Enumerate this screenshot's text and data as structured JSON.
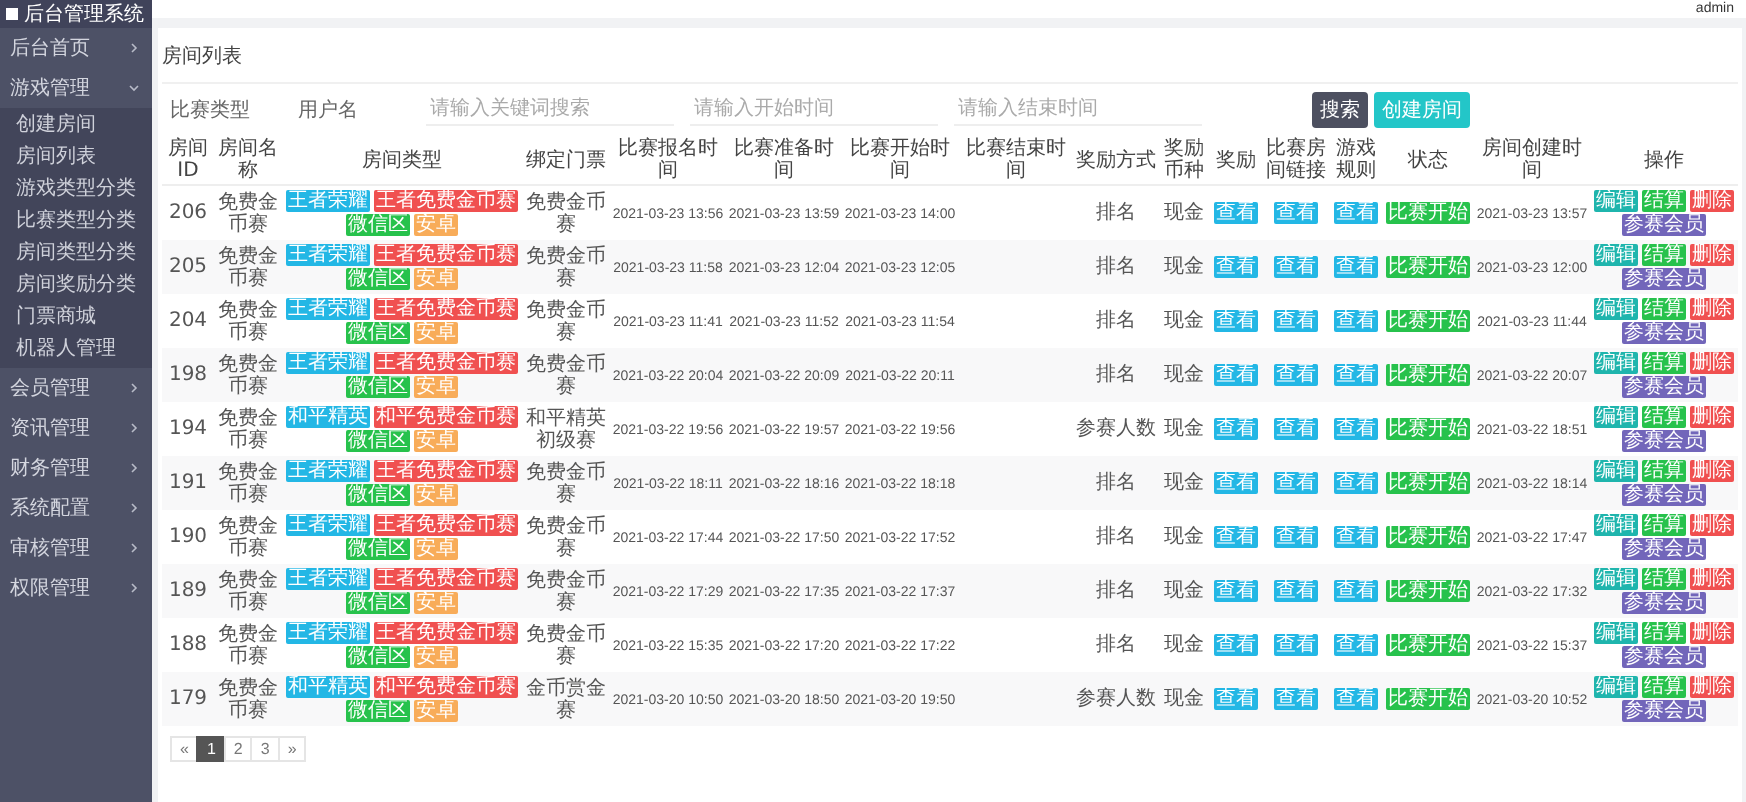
{
  "header": {
    "brand": "后台管理系统",
    "user": "admin"
  },
  "sidebar": {
    "items": [
      {
        "label": "后台首页",
        "expanded": false
      },
      {
        "label": "游戏管理",
        "expanded": true,
        "children": [
          "创建房间",
          "房间列表",
          "游戏类型分类",
          "比赛类型分类",
          "房间类型分类",
          "房间奖励分类",
          "门票商城",
          "机器人管理"
        ]
      },
      {
        "label": "会员管理",
        "expanded": false
      },
      {
        "label": "资讯管理",
        "expanded": false
      },
      {
        "label": "财务管理",
        "expanded": false
      },
      {
        "label": "系统配置",
        "expanded": false
      },
      {
        "label": "审核管理",
        "expanded": false
      },
      {
        "label": "权限管理",
        "expanded": false
      }
    ]
  },
  "page_title": "房间列表",
  "filters": {
    "labels": [
      "比赛类型",
      "用户名"
    ],
    "inputs": [
      {
        "placeholder": "请输入关键词搜索"
      },
      {
        "placeholder": "请输入开始时间"
      },
      {
        "placeholder": "请输入结束时间"
      }
    ],
    "buttons": [
      {
        "label": "搜索",
        "kind": "search"
      },
      {
        "label": "创建房间",
        "kind": "create"
      }
    ]
  },
  "table": {
    "columns": [
      "房间ID",
      "房间名称",
      "房间类型",
      "绑定门票",
      "比赛报名时间",
      "比赛准备时间",
      "比赛开始时间",
      "比赛结束时间",
      "奖励方式",
      "奖励币种",
      "奖励",
      "比赛房间链接",
      "游戏规则",
      "状态",
      "房间创建时间",
      "操作"
    ],
    "rows": [
      {
        "id": "206",
        "name": "免费金币赛",
        "type_tags": [
          {
            "text": "王者荣耀",
            "color": "#23b7e5"
          },
          {
            "text": "王者免费金币赛",
            "color": "#f05050"
          },
          {
            "text": "微信区",
            "color": "#27c24c"
          },
          {
            "text": "安卓",
            "color": "#f8ac59"
          }
        ],
        "ticket": "免费金币赛",
        "signup_time": "2021-03-23 13:56",
        "prepare_time": "2021-03-23 13:59",
        "start_time": "2021-03-23 14:00",
        "reward_mode": "排名",
        "currency": "现金",
        "reward": "查看",
        "room_link": "查看",
        "rules": "查看",
        "status": "比赛开始",
        "created_time": "2021-03-23 13:57",
        "actions": [
          {
            "label": "编辑",
            "color": "#1fb5ad"
          },
          {
            "label": "结算",
            "color": "#27c24c"
          },
          {
            "label": "删除",
            "color": "#f05050"
          },
          {
            "label": "参赛会员",
            "color": "#7266ba"
          }
        ]
      },
      {
        "id": "205",
        "name": "免费金币赛",
        "type_tags": [
          {
            "text": "王者荣耀",
            "color": "#23b7e5"
          },
          {
            "text": "王者免费金币赛",
            "color": "#f05050"
          },
          {
            "text": "微信区",
            "color": "#27c24c"
          },
          {
            "text": "安卓",
            "color": "#f8ac59"
          }
        ],
        "ticket": "免费金币赛",
        "signup_time": "2021-03-23 11:58",
        "prepare_time": "2021-03-23 12:04",
        "start_time": "2021-03-23 12:05",
        "reward_mode": "排名",
        "currency": "现金",
        "reward": "查看",
        "room_link": "查看",
        "rules": "查看",
        "status": "比赛开始",
        "created_time": "2021-03-23 12:00",
        "actions": [
          {
            "label": "编辑",
            "color": "#1fb5ad"
          },
          {
            "label": "结算",
            "color": "#27c24c"
          },
          {
            "label": "删除",
            "color": "#f05050"
          },
          {
            "label": "参赛会员",
            "color": "#7266ba"
          }
        ]
      },
      {
        "id": "204",
        "name": "免费金币赛",
        "type_tags": [
          {
            "text": "王者荣耀",
            "color": "#23b7e5"
          },
          {
            "text": "王者免费金币赛",
            "color": "#f05050"
          },
          {
            "text": "微信区",
            "color": "#27c24c"
          },
          {
            "text": "安卓",
            "color": "#f8ac59"
          }
        ],
        "ticket": "免费金币赛",
        "signup_time": "2021-03-23 11:41",
        "prepare_time": "2021-03-23 11:52",
        "start_time": "2021-03-23 11:54",
        "reward_mode": "排名",
        "currency": "现金",
        "reward": "查看",
        "room_link": "查看",
        "rules": "查看",
        "status": "比赛开始",
        "created_time": "2021-03-23 11:44",
        "actions": [
          {
            "label": "编辑",
            "color": "#1fb5ad"
          },
          {
            "label": "结算",
            "color": "#27c24c"
          },
          {
            "label": "删除",
            "color": "#f05050"
          },
          {
            "label": "参赛会员",
            "color": "#7266ba"
          }
        ]
      },
      {
        "id": "198",
        "name": "免费金币赛",
        "type_tags": [
          {
            "text": "王者荣耀",
            "color": "#23b7e5"
          },
          {
            "text": "王者免费金币赛",
            "color": "#f05050"
          },
          {
            "text": "微信区",
            "color": "#27c24c"
          },
          {
            "text": "安卓",
            "color": "#f8ac59"
          }
        ],
        "ticket": "免费金币赛",
        "signup_time": "2021-03-22 20:04",
        "prepare_time": "2021-03-22 20:09",
        "start_time": "2021-03-22 20:11",
        "reward_mode": "排名",
        "currency": "现金",
        "reward": "查看",
        "room_link": "查看",
        "rules": "查看",
        "status": "比赛开始",
        "created_time": "2021-03-22 20:07",
        "actions": [
          {
            "label": "编辑",
            "color": "#1fb5ad"
          },
          {
            "label": "结算",
            "color": "#27c24c"
          },
          {
            "label": "删除",
            "color": "#f05050"
          },
          {
            "label": "参赛会员",
            "color": "#7266ba"
          }
        ]
      },
      {
        "id": "194",
        "name": "免费金币赛",
        "type_tags": [
          {
            "text": "和平精英",
            "color": "#23b7e5"
          },
          {
            "text": "和平免费金币赛",
            "color": "#f05050"
          },
          {
            "text": "微信区",
            "color": "#27c24c"
          },
          {
            "text": "安卓",
            "color": "#f8ac59"
          }
        ],
        "ticket": "和平精英初级赛",
        "signup_time": "2021-03-22 19:56",
        "prepare_time": "2021-03-22 19:57",
        "start_time": "2021-03-22 19:56",
        "reward_mode": "参赛人数",
        "currency": "现金",
        "reward": "查看",
        "room_link": "查看",
        "rules": "查看",
        "status": "比赛开始",
        "created_time": "2021-03-22 18:51",
        "actions": [
          {
            "label": "编辑",
            "color": "#1fb5ad"
          },
          {
            "label": "结算",
            "color": "#27c24c"
          },
          {
            "label": "删除",
            "color": "#f05050"
          },
          {
            "label": "参赛会员",
            "color": "#7266ba"
          }
        ]
      },
      {
        "id": "191",
        "name": "免费金币赛",
        "type_tags": [
          {
            "text": "王者荣耀",
            "color": "#23b7e5"
          },
          {
            "text": "王者免费金币赛",
            "color": "#f05050"
          },
          {
            "text": "微信区",
            "color": "#27c24c"
          },
          {
            "text": "安卓",
            "color": "#f8ac59"
          }
        ],
        "ticket": "免费金币赛",
        "signup_time": "2021-03-22 18:11",
        "prepare_time": "2021-03-22 18:16",
        "start_time": "2021-03-22 18:18",
        "reward_mode": "排名",
        "currency": "现金",
        "reward": "查看",
        "room_link": "查看",
        "rules": "查看",
        "status": "比赛开始",
        "created_time": "2021-03-22 18:14",
        "actions": [
          {
            "label": "编辑",
            "color": "#1fb5ad"
          },
          {
            "label": "结算",
            "color": "#27c24c"
          },
          {
            "label": "删除",
            "color": "#f05050"
          },
          {
            "label": "参赛会员",
            "color": "#7266ba"
          }
        ]
      },
      {
        "id": "190",
        "name": "免费金币赛",
        "type_tags": [
          {
            "text": "王者荣耀",
            "color": "#23b7e5"
          },
          {
            "text": "王者免费金币赛",
            "color": "#f05050"
          },
          {
            "text": "微信区",
            "color": "#27c24c"
          },
          {
            "text": "安卓",
            "color": "#f8ac59"
          }
        ],
        "ticket": "免费金币赛",
        "signup_time": "2021-03-22 17:44",
        "prepare_time": "2021-03-22 17:50",
        "start_time": "2021-03-22 17:52",
        "reward_mode": "排名",
        "currency": "现金",
        "reward": "查看",
        "room_link": "查看",
        "rules": "查看",
        "status": "比赛开始",
        "created_time": "2021-03-22 17:47",
        "actions": [
          {
            "label": "编辑",
            "color": "#1fb5ad"
          },
          {
            "label": "结算",
            "color": "#27c24c"
          },
          {
            "label": "删除",
            "color": "#f05050"
          },
          {
            "label": "参赛会员",
            "color": "#7266ba"
          }
        ]
      },
      {
        "id": "189",
        "name": "免费金币赛",
        "type_tags": [
          {
            "text": "王者荣耀",
            "color": "#23b7e5"
          },
          {
            "text": "王者免费金币赛",
            "color": "#f05050"
          },
          {
            "text": "微信区",
            "color": "#27c24c"
          },
          {
            "text": "安卓",
            "color": "#f8ac59"
          }
        ],
        "ticket": "免费金币赛",
        "signup_time": "2021-03-22 17:29",
        "prepare_time": "2021-03-22 17:35",
        "start_time": "2021-03-22 17:37",
        "reward_mode": "排名",
        "currency": "现金",
        "reward": "查看",
        "room_link": "查看",
        "rules": "查看",
        "status": "比赛开始",
        "created_time": "2021-03-22 17:32",
        "actions": [
          {
            "label": "编辑",
            "color": "#1fb5ad"
          },
          {
            "label": "结算",
            "color": "#27c24c"
          },
          {
            "label": "删除",
            "color": "#f05050"
          },
          {
            "label": "参赛会员",
            "color": "#7266ba"
          }
        ]
      },
      {
        "id": "188",
        "name": "免费金币赛",
        "type_tags": [
          {
            "text": "王者荣耀",
            "color": "#23b7e5"
          },
          {
            "text": "王者免费金币赛",
            "color": "#f05050"
          },
          {
            "text": "微信区",
            "color": "#27c24c"
          },
          {
            "text": "安卓",
            "color": "#f8ac59"
          }
        ],
        "ticket": "免费金币赛",
        "signup_time": "2021-03-22 15:35",
        "prepare_time": "2021-03-22 17:20",
        "start_time": "2021-03-22 17:22",
        "reward_mode": "排名",
        "currency": "现金",
        "reward": "查看",
        "room_link": "查看",
        "rules": "查看",
        "status": "比赛开始",
        "created_time": "2021-03-22 15:37",
        "actions": [
          {
            "label": "编辑",
            "color": "#1fb5ad"
          },
          {
            "label": "结算",
            "color": "#27c24c"
          },
          {
            "label": "删除",
            "color": "#f05050"
          },
          {
            "label": "参赛会员",
            "color": "#7266ba"
          }
        ]
      },
      {
        "id": "179",
        "name": "免费金币赛",
        "type_tags": [
          {
            "text": "和平精英",
            "color": "#23b7e5"
          },
          {
            "text": "和平免费金币赛",
            "color": "#f05050"
          },
          {
            "text": "微信区",
            "color": "#27c24c"
          },
          {
            "text": "安卓",
            "color": "#f8ac59"
          }
        ],
        "ticket": "金币赏金赛",
        "signup_time": "2021-03-20 10:50",
        "prepare_time": "2021-03-20 18:50",
        "start_time": "2021-03-20 19:50",
        "reward_mode": "参赛人数",
        "currency": "现金",
        "reward": "查看",
        "room_link": "查看",
        "rules": "查看",
        "status": "比赛开始",
        "created_time": "2021-03-20 10:52",
        "actions": [
          {
            "label": "编辑",
            "color": "#1fb5ad"
          },
          {
            "label": "结算",
            "color": "#27c24c"
          },
          {
            "label": "删除",
            "color": "#f05050"
          },
          {
            "label": "参赛会员",
            "color": "#7266ba"
          }
        ]
      }
    ]
  },
  "pagination": [
    {
      "label": "«",
      "selected": false
    },
    {
      "label": "1",
      "selected": true
    },
    {
      "label": "2",
      "selected": false
    },
    {
      "label": "3",
      "selected": false
    },
    {
      "label": "»",
      "selected": false
    }
  ]
}
